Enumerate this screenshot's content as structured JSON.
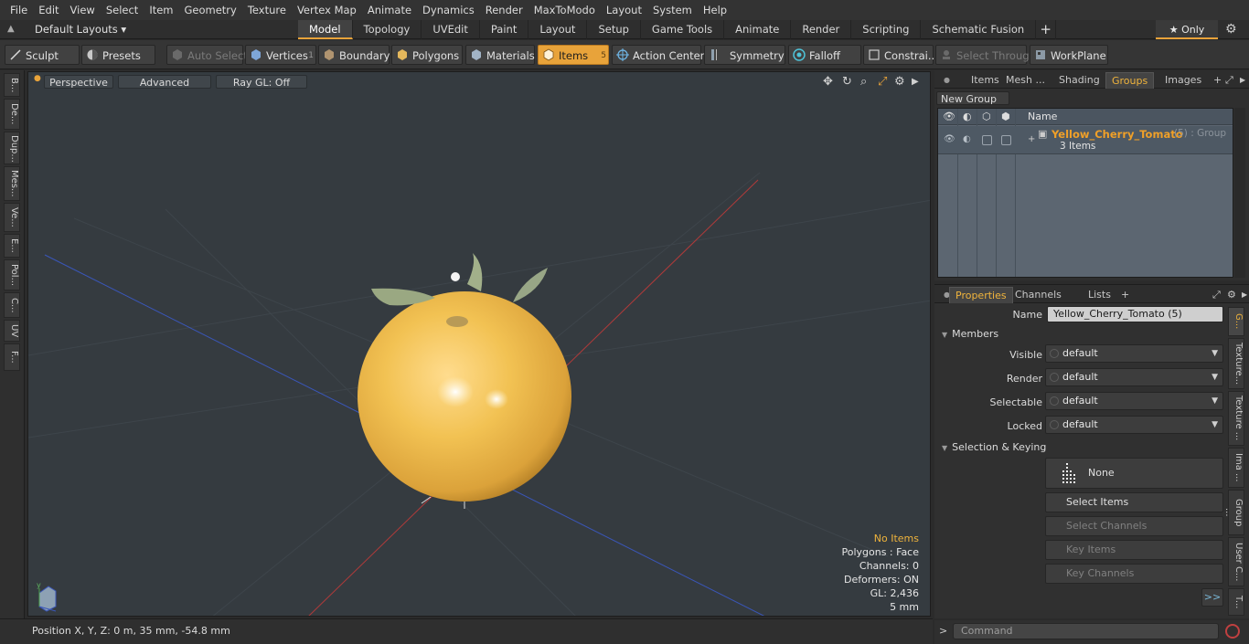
{
  "menu": [
    "File",
    "Edit",
    "View",
    "Select",
    "Item",
    "Geometry",
    "Texture",
    "Vertex Map",
    "Animate",
    "Dynamics",
    "Render",
    "MaxToModo",
    "Layout",
    "System",
    "Help"
  ],
  "layouts": {
    "selector": "Default Layouts ▾"
  },
  "tabs": [
    "Model",
    "Topology",
    "UVEdit",
    "Paint",
    "Layout",
    "Setup",
    "Game Tools",
    "Animate",
    "Render",
    "Scripting",
    "Schematic Fusion"
  ],
  "active_tab": "Model",
  "only_button": "★  Only",
  "toolbar": {
    "sculpt": "Sculpt",
    "presets": "Presets",
    "auto_select": "Auto Select",
    "vertices": "Vertices",
    "vertices_count": "1",
    "boundary": "Boundary",
    "polygons": "Polygons",
    "materials": "Materials",
    "items": "Items",
    "items_count": "5",
    "action_center": "Action Center",
    "symmetry": "Symmetry",
    "falloff": "Falloff",
    "constraints": "Constrai...",
    "select_through": "Select Through",
    "workplane": "WorkPlane"
  },
  "left_tabs": [
    "B...",
    "De...",
    "Dup...",
    "Mes...",
    "Ve...",
    "E...",
    "Pol...",
    "C...",
    "UV",
    "F..."
  ],
  "viewport": {
    "perspective": "Perspective",
    "advanced": "Advanced",
    "raygl": "Ray GL: Off",
    "stats": {
      "no_items": "No Items",
      "polygons": "Polygons : Face",
      "channels": "Channels: 0",
      "deformers": "Deformers: ON",
      "gl": "GL: 2,436",
      "scale": "5 mm"
    }
  },
  "status": {
    "position": "Position X, Y, Z:   0 m, 35 mm, -54.8 mm"
  },
  "top_panel": {
    "tabs": [
      "Items",
      "Mesh ...",
      "Shading",
      "Groups",
      "Images"
    ],
    "active": "Groups",
    "new_group": "New Group",
    "col_name": "Name",
    "group": {
      "name": "Yellow_Cherry_Tomato",
      "meta": "(5) : Group",
      "count": "3 Items"
    }
  },
  "properties": {
    "tabs": [
      "Properties",
      "Channels",
      "Lists"
    ],
    "active": "Properties",
    "name_label": "Name",
    "name_value": "Yellow_Cherry_Tomato (5)",
    "members": "Members",
    "visible_label": "Visible",
    "visible_value": "default",
    "render_label": "Render",
    "render_value": "default",
    "selectable_label": "Selectable",
    "selectable_value": "default",
    "locked_label": "Locked",
    "locked_value": "default",
    "selection_keying": "Selection & Keying",
    "none_btn": "None",
    "select_items": "Select Items",
    "select_channels": "Select Channels",
    "key_items": "Key Items",
    "key_channels": "Key Channels",
    "expand": ">>",
    "side_tabs": [
      "G...",
      "Texture...",
      "Texture ...",
      "Ima ...",
      "Group ...",
      "User C...",
      "T..."
    ]
  },
  "command": {
    "placeholder": "Command",
    "prompt": ">"
  },
  "colors": {
    "accent": "#e8a33a",
    "group_name": "#f0a028",
    "viewport_bg": "#353b40"
  }
}
